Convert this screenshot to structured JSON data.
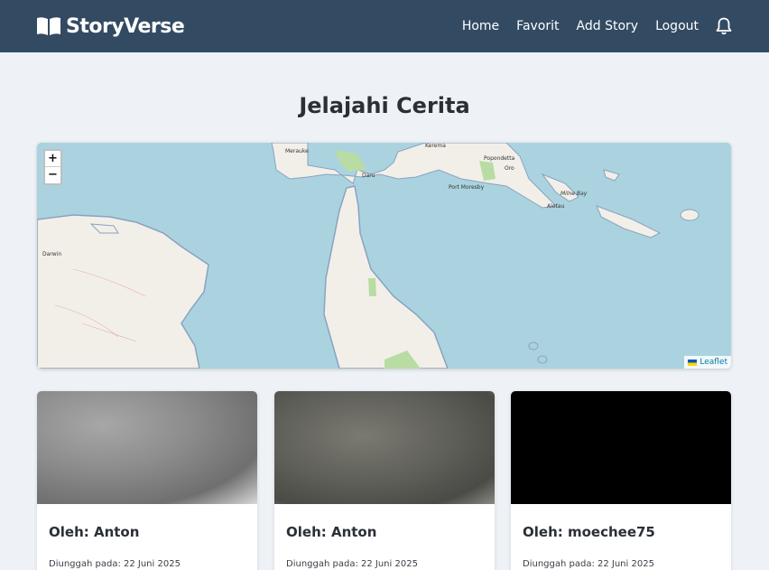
{
  "header": {
    "brand": "StoryVerse",
    "nav": [
      {
        "label": "Home"
      },
      {
        "label": "Favorit"
      },
      {
        "label": "Add Story"
      },
      {
        "label": "Logout"
      }
    ],
    "bell_icon": "bell-icon",
    "background_color": "#334a63"
  },
  "main": {
    "title": "Jelajahi Cerita"
  },
  "map": {
    "zoom_in": "+",
    "zoom_out": "−",
    "attribution": "Leaflet",
    "places": [
      "Merauke",
      "Daru",
      "Kerema",
      "Popondetta",
      "Oro",
      "Port Moresby",
      "Milne Bay",
      "Alotau",
      "Darwin"
    ]
  },
  "stories": [
    {
      "author": "Oleh: Anton",
      "date": "Diunggah pada: 22 Juni 2025"
    },
    {
      "author": "Oleh: Anton",
      "date": "Diunggah pada: 22 Juni 2025"
    },
    {
      "author": "Oleh: moechee75",
      "date": "Diunggah pada: 22 Juni 2025"
    }
  ]
}
